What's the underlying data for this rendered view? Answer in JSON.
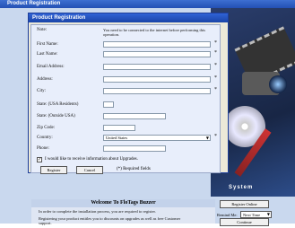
{
  "background": {
    "window_title": "Product Registration",
    "art_label": "System",
    "welcome_title": "Welcome To FloTags Buzzer",
    "welcome_lines": [
      "In order to complete the installation process, you are required to register.",
      "Registering your product entitles you to discounts on upgrades as well as free Customer support."
    ],
    "register_online_label": "Register Online",
    "remind_label": "Remind Me:",
    "remind_value": "Next Time",
    "continue_label": "Continue"
  },
  "dialog": {
    "title": "Product Registration",
    "note_label": "Note:",
    "note_text": "You need to be connected to the internet before performing this operation.",
    "fields": [
      {
        "label": "First Name:",
        "required": "*"
      },
      {
        "label": "Last Name:",
        "required": "*"
      },
      {
        "label": "Email Address:",
        "required": "*"
      },
      {
        "label": "Address:",
        "required": "*"
      },
      {
        "label": "City:",
        "required": "*"
      },
      {
        "label": "State: (USA Residents)",
        "required": ""
      },
      {
        "label": "State: (Outside USA)",
        "required": ""
      },
      {
        "label": "Zip Code:",
        "required": ""
      },
      {
        "label": "Country:",
        "value": "United States",
        "required": "*"
      },
      {
        "label": "Phone:",
        "required": ""
      }
    ],
    "upgrade_check_label": "I would like to receive information about Upgrades.",
    "upgrade_checked": "✓",
    "register_label": "Register",
    "cancel_label": "Cancel",
    "required_note": "(*) Required fields"
  }
}
